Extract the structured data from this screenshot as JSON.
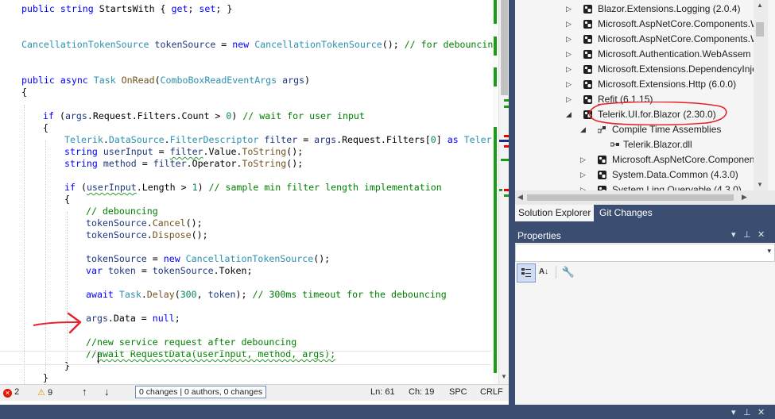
{
  "code": {
    "lines": [
      {
        "indent": 1,
        "tokens": [
          {
            "t": "public",
            "c": "kw"
          },
          {
            "t": " "
          },
          {
            "t": "string",
            "c": "kw"
          },
          {
            "t": " StartsWith "
          },
          {
            "t": "{"
          },
          {
            "t": " "
          },
          {
            "t": "get",
            "c": "kw"
          },
          {
            "t": "; "
          },
          {
            "t": "set",
            "c": "kw"
          },
          {
            "t": "; }"
          }
        ]
      },
      {
        "indent": 0,
        "tokens": []
      },
      {
        "indent": 0,
        "tokens": []
      },
      {
        "indent": 1,
        "tokens": [
          {
            "t": "CancellationTokenSource",
            "c": "ty"
          },
          {
            "t": " "
          },
          {
            "t": "tokenSource",
            "c": "id"
          },
          {
            "t": " = "
          },
          {
            "t": "new",
            "c": "kw"
          },
          {
            "t": " "
          },
          {
            "t": "CancellationTokenSource",
            "c": "ty"
          },
          {
            "t": "(); "
          },
          {
            "t": "// for debouncing t",
            "c": "cm"
          }
        ]
      },
      {
        "indent": 0,
        "tokens": []
      },
      {
        "indent": 0,
        "tokens": []
      },
      {
        "indent": 1,
        "tokens": [
          {
            "t": "public",
            "c": "kw"
          },
          {
            "t": " "
          },
          {
            "t": "async",
            "c": "kw"
          },
          {
            "t": " "
          },
          {
            "t": "Task",
            "c": "ty"
          },
          {
            "t": " "
          },
          {
            "t": "OnRead",
            "c": "mt"
          },
          {
            "t": "("
          },
          {
            "t": "ComboBoxReadEventArgs",
            "c": "ty"
          },
          {
            "t": " "
          },
          {
            "t": "args",
            "c": "id"
          },
          {
            "t": ")"
          }
        ]
      },
      {
        "indent": 1,
        "tokens": [
          {
            "t": "{"
          }
        ]
      },
      {
        "indent": 0,
        "tokens": []
      },
      {
        "indent": 2,
        "tokens": [
          {
            "t": "if",
            "c": "kw"
          },
          {
            "t": " ("
          },
          {
            "t": "args",
            "c": "id"
          },
          {
            "t": ".Request.Filters.Count > "
          },
          {
            "t": "0",
            "c": "nm"
          },
          {
            "t": ") "
          },
          {
            "t": "// wait for user input",
            "c": "cm"
          }
        ]
      },
      {
        "indent": 2,
        "tokens": [
          {
            "t": "{"
          }
        ]
      },
      {
        "indent": 3,
        "tokens": [
          {
            "t": "Telerik",
            "c": "ty"
          },
          {
            "t": "."
          },
          {
            "t": "DataSource",
            "c": "ty"
          },
          {
            "t": "."
          },
          {
            "t": "FilterDescriptor",
            "c": "ty"
          },
          {
            "t": " "
          },
          {
            "t": "filter",
            "c": "id"
          },
          {
            "t": " = "
          },
          {
            "t": "args",
            "c": "id"
          },
          {
            "t": ".Request.Filters["
          },
          {
            "t": "0",
            "c": "nm"
          },
          {
            "t": "] "
          },
          {
            "t": "as",
            "c": "kw"
          },
          {
            "t": " "
          },
          {
            "t": "Telerik",
            "c": "ty"
          }
        ]
      },
      {
        "indent": 3,
        "tokens": [
          {
            "t": "string",
            "c": "kw"
          },
          {
            "t": " "
          },
          {
            "t": "userInput",
            "c": "id"
          },
          {
            "t": " = "
          },
          {
            "t": "filter",
            "c": "id",
            "sq": true
          },
          {
            "t": ".Value."
          },
          {
            "t": "ToString",
            "c": "mt"
          },
          {
            "t": "();"
          }
        ]
      },
      {
        "indent": 3,
        "tokens": [
          {
            "t": "string",
            "c": "kw"
          },
          {
            "t": " "
          },
          {
            "t": "method",
            "c": "id"
          },
          {
            "t": " = "
          },
          {
            "t": "filter",
            "c": "id"
          },
          {
            "t": ".Operator."
          },
          {
            "t": "ToString",
            "c": "mt"
          },
          {
            "t": "();"
          }
        ]
      },
      {
        "indent": 0,
        "tokens": []
      },
      {
        "indent": 3,
        "tokens": [
          {
            "t": "if",
            "c": "kw"
          },
          {
            "t": " ("
          },
          {
            "t": "userInput",
            "c": "id",
            "sq": true
          },
          {
            "t": ".Length > "
          },
          {
            "t": "1",
            "c": "nm"
          },
          {
            "t": ") "
          },
          {
            "t": "// sample min filter length implementation",
            "c": "cm"
          }
        ]
      },
      {
        "indent": 3,
        "tokens": [
          {
            "t": "{"
          }
        ]
      },
      {
        "indent": 4,
        "tokens": [
          {
            "t": "// debouncing",
            "c": "cm"
          }
        ]
      },
      {
        "indent": 4,
        "tokens": [
          {
            "t": "tokenSource",
            "c": "id"
          },
          {
            "t": "."
          },
          {
            "t": "Cancel",
            "c": "mt"
          },
          {
            "t": "();"
          }
        ]
      },
      {
        "indent": 4,
        "tokens": [
          {
            "t": "tokenSource",
            "c": "id"
          },
          {
            "t": "."
          },
          {
            "t": "Dispose",
            "c": "mt"
          },
          {
            "t": "();"
          }
        ]
      },
      {
        "indent": 0,
        "tokens": []
      },
      {
        "indent": 4,
        "tokens": [
          {
            "t": "tokenSource",
            "c": "id"
          },
          {
            "t": " = "
          },
          {
            "t": "new",
            "c": "kw"
          },
          {
            "t": " "
          },
          {
            "t": "CancellationTokenSource",
            "c": "ty"
          },
          {
            "t": "();"
          }
        ]
      },
      {
        "indent": 4,
        "tokens": [
          {
            "t": "var",
            "c": "kw"
          },
          {
            "t": " "
          },
          {
            "t": "token",
            "c": "id"
          },
          {
            "t": " = "
          },
          {
            "t": "tokenSource",
            "c": "id"
          },
          {
            "t": ".Token;"
          }
        ]
      },
      {
        "indent": 0,
        "tokens": []
      },
      {
        "indent": 4,
        "tokens": [
          {
            "t": "await",
            "c": "kw"
          },
          {
            "t": " "
          },
          {
            "t": "Task",
            "c": "ty"
          },
          {
            "t": "."
          },
          {
            "t": "Delay",
            "c": "mt"
          },
          {
            "t": "("
          },
          {
            "t": "300",
            "c": "nm"
          },
          {
            "t": ", "
          },
          {
            "t": "token",
            "c": "id"
          },
          {
            "t": "); "
          },
          {
            "t": "// 300ms timeout for the debouncing",
            "c": "cm"
          }
        ]
      },
      {
        "indent": 0,
        "tokens": []
      },
      {
        "indent": 4,
        "tokens": [
          {
            "t": "args",
            "c": "id"
          },
          {
            "t": ".Data = "
          },
          {
            "t": "null",
            "c": "kw"
          },
          {
            "t": ";"
          }
        ]
      },
      {
        "indent": 0,
        "tokens": []
      },
      {
        "indent": 4,
        "tokens": [
          {
            "t": "//new service request after debouncing",
            "c": "cm"
          }
        ]
      },
      {
        "indent": 4,
        "tokens": [
          {
            "t": "//",
            "c": "cm"
          },
          {
            "t": "await RequestData(userInput, method, args);",
            "c": "cm",
            "sq": true
          }
        ]
      },
      {
        "indent": 3,
        "tokens": [
          {
            "t": "}"
          }
        ]
      },
      {
        "indent": 2,
        "tokens": [
          {
            "t": "}"
          }
        ]
      }
    ]
  },
  "status_bar": {
    "errors": "2",
    "warnings": "9",
    "changes": "0 changes",
    "authors": "0 authors, 0 changes",
    "line": "Ln: 61",
    "col": "Ch: 19",
    "spacing": "SPC",
    "line_ending": "CRLF"
  },
  "solution_tree": [
    {
      "level": 1,
      "arrow": "collapsed",
      "label": "Blazor.Extensions.Logging (2.0.4)"
    },
    {
      "level": 1,
      "arrow": "collapsed",
      "label": "Microsoft.AspNetCore.Components.W"
    },
    {
      "level": 1,
      "arrow": "collapsed",
      "label": "Microsoft.AspNetCore.Components.W"
    },
    {
      "level": 1,
      "arrow": "collapsed",
      "label": "Microsoft.Authentication.WebAssem"
    },
    {
      "level": 1,
      "arrow": "collapsed",
      "label": "Microsoft.Extensions.DependencyInje"
    },
    {
      "level": 1,
      "arrow": "collapsed",
      "label": "Microsoft.Extensions.Http (6.0.0)"
    },
    {
      "level": 1,
      "arrow": "collapsed",
      "label": "Refit (6.1.15)"
    },
    {
      "level": 1,
      "arrow": "expanded",
      "label": "Telerik.UI.for.Blazor (2.30.0)"
    },
    {
      "level": 2,
      "arrow": "expanded",
      "label": "Compile Time Assemblies"
    },
    {
      "level": 3,
      "arrow": "none",
      "label": "Telerik.Blazor.dll"
    },
    {
      "level": 2,
      "arrow": "collapsed",
      "label": "Microsoft.AspNetCore.Componen"
    },
    {
      "level": 2,
      "arrow": "collapsed",
      "label": "System.Data.Common (4.3.0)"
    },
    {
      "level": 2,
      "arrow": "collapsed",
      "label": "System.Linq.Queryable (4.3.0)"
    }
  ],
  "tabs": [
    "Solution Explorer",
    "Git Changes"
  ],
  "properties": {
    "title": "Properties"
  },
  "colors": {
    "accent": "#3b4d70",
    "annotation": "#e8212b",
    "git_added": "#1a9e1a"
  }
}
